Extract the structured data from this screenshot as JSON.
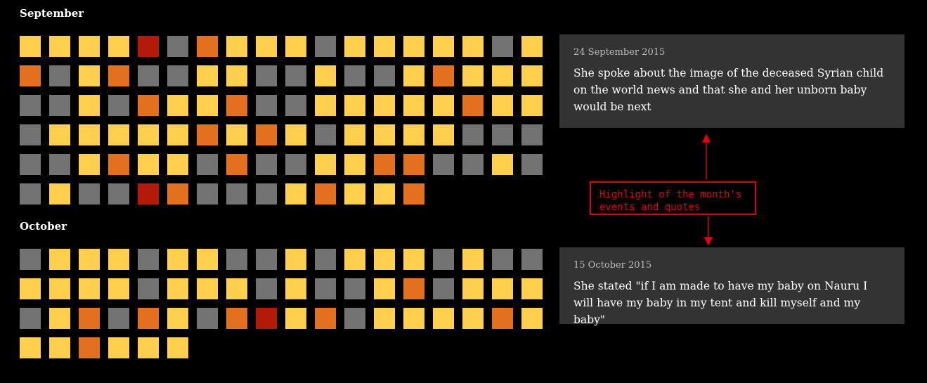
{
  "months": [
    {
      "title": "September",
      "cells": [
        "y",
        "y",
        "y",
        "y",
        "r",
        "g",
        "o",
        "y",
        "y",
        "y",
        "g",
        "y",
        "y",
        "y",
        "y",
        "y",
        "g",
        "y",
        "o",
        "g",
        "y",
        "o",
        "g",
        "g",
        "y",
        "y",
        "g",
        "g",
        "y",
        "g",
        "g",
        "y",
        "o",
        "y",
        "y",
        "y",
        "g",
        "g",
        "y",
        "g",
        "o",
        "y",
        "y",
        "o",
        "g",
        "g",
        "y",
        "y",
        "y",
        "y",
        "y",
        "o",
        "y",
        "y",
        "g",
        "y",
        "y",
        "y",
        "y",
        "y",
        "o",
        "y",
        "o",
        "y",
        "g",
        "y",
        "y",
        "y",
        "y",
        "g",
        "g",
        "g",
        "g",
        "g",
        "y",
        "o",
        "y",
        "y",
        "g",
        "o",
        "g",
        "g",
        "y",
        "y",
        "o",
        "o",
        "g",
        "g",
        "y",
        "g",
        "g",
        "y",
        "g",
        "g",
        "r",
        "o",
        "g",
        "g",
        "g",
        "y",
        "o",
        "y",
        "y",
        "o"
      ],
      "highlight": {
        "date": "24 September 2015",
        "quote": "She spoke about the image of the deceased Syrian child on the world news and that she and her unborn baby would be next"
      }
    },
    {
      "title": "October",
      "cells": [
        "g",
        "y",
        "y",
        "y",
        "g",
        "y",
        "y",
        "g",
        "g",
        "y",
        "g",
        "y",
        "y",
        "y",
        "g",
        "y",
        "g",
        "g",
        "y",
        "y",
        "y",
        "y",
        "g",
        "y",
        "y",
        "y",
        "g",
        "y",
        "g",
        "g",
        "y",
        "o",
        "g",
        "y",
        "y",
        "y",
        "g",
        "y",
        "o",
        "g",
        "o",
        "y",
        "g",
        "o",
        "r",
        "y",
        "o",
        "g",
        "y",
        "y",
        "y",
        "y",
        "o",
        "y",
        "y",
        "y",
        "o",
        "y",
        "y",
        "y"
      ],
      "highlight": {
        "date": "15 October 2015",
        "quote": "She stated \"if I am made to have my baby on Nauru I will have my baby in my tent and kill myself and my baby\""
      }
    }
  ],
  "annotation": {
    "text": "Highlight of the month's events and quotes",
    "color": "#e0000f"
  },
  "colors": {
    "y": "#ffcf4d",
    "o": "#e2701e",
    "r": "#b31a0a",
    "g": "#737373",
    "card_bg": "#333333"
  }
}
